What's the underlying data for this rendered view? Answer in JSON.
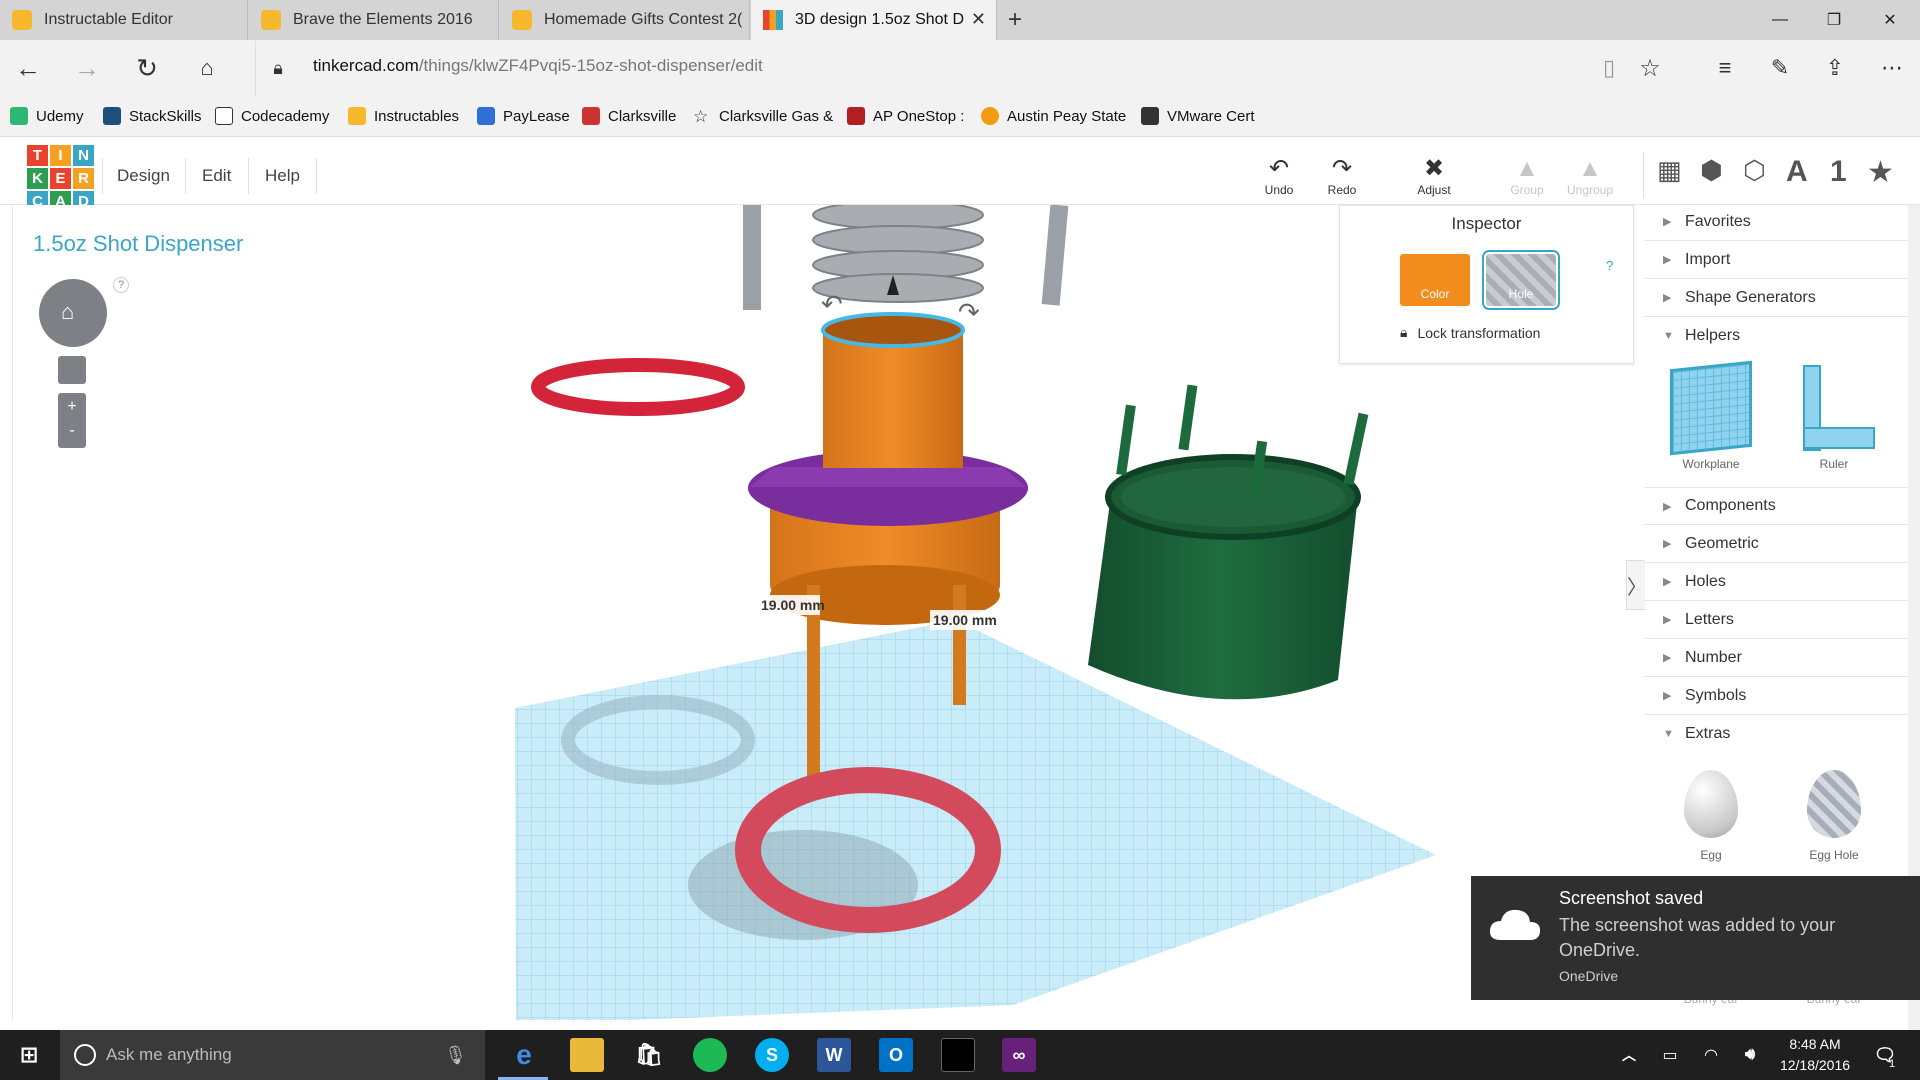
{
  "browser": {
    "tabs": [
      {
        "title": "Instructable Editor",
        "active": false
      },
      {
        "title": "Brave the Elements 2016",
        "active": false
      },
      {
        "title": "Homemade Gifts Contest 2(",
        "active": false
      },
      {
        "title": "3D design 1.5oz Shot D",
        "active": true
      }
    ],
    "new_tab_symbol": "+",
    "url_domain": "tinkercad.com",
    "url_path": "/things/klwZF4Pvqi5-15oz-shot-dispenser/edit",
    "favorites": [
      "Udemy",
      "StackSkills",
      "Codecademy",
      "Instructables",
      "PayLease",
      "Clarksville",
      "Clarksville Gas &",
      "AP OneStop :",
      "Austin Peay State",
      "VMware Cert"
    ]
  },
  "app": {
    "logo_letters": [
      "T",
      "I",
      "N",
      "K",
      "E",
      "R",
      "C",
      "A",
      "D"
    ],
    "logo_colors": [
      "#e8432e",
      "#f6a022",
      "#3aa6c6",
      "#2d9d4f",
      "#e8432e",
      "#f6a022",
      "#3aa6c6",
      "#2d9d4f",
      "#3aa6c6"
    ],
    "menu": [
      "Design",
      "Edit",
      "Help"
    ],
    "toolbar": {
      "undo": "Undo",
      "redo": "Redo",
      "adjust": "Adjust",
      "group": "Group",
      "ungroup": "Ungroup"
    },
    "design_title": "1.5oz Shot Dispenser",
    "help_mark": "?",
    "zoom_in": "+",
    "zoom_out": "-",
    "workplane_label": "Workplane",
    "dimensions": [
      "19.00",
      "19.00"
    ],
    "dimension_unit": "mm"
  },
  "inspector": {
    "title": "Inspector",
    "color_label": "Color",
    "hole_label": "Hole",
    "help": "?",
    "lock_label": "Lock transformation",
    "color_value": "#f28c1c"
  },
  "panel": {
    "categories": [
      {
        "label": "Favorites",
        "open": false
      },
      {
        "label": "Import",
        "open": false
      },
      {
        "label": "Shape Generators",
        "open": false
      },
      {
        "label": "Helpers",
        "open": true
      },
      {
        "label": "Components",
        "open": false
      },
      {
        "label": "Geometric",
        "open": false
      },
      {
        "label": "Holes",
        "open": false
      },
      {
        "label": "Letters",
        "open": false
      },
      {
        "label": "Number",
        "open": false
      },
      {
        "label": "Symbols",
        "open": false
      },
      {
        "label": "Extras",
        "open": true
      }
    ],
    "helpers": [
      "Workplane",
      "Ruler"
    ],
    "extras": [
      "Egg",
      "Egg Hole"
    ],
    "hidden_labels": [
      "Bunny ear",
      "Bunny ear"
    ]
  },
  "toast": {
    "title": "Screenshot saved",
    "body": "The screenshot was added to your OneDrive.",
    "source": "OneDrive"
  },
  "taskbar": {
    "search_placeholder": "Ask me anything",
    "time": "8:48 AM",
    "date": "12/18/2016",
    "notification_count": "1"
  }
}
